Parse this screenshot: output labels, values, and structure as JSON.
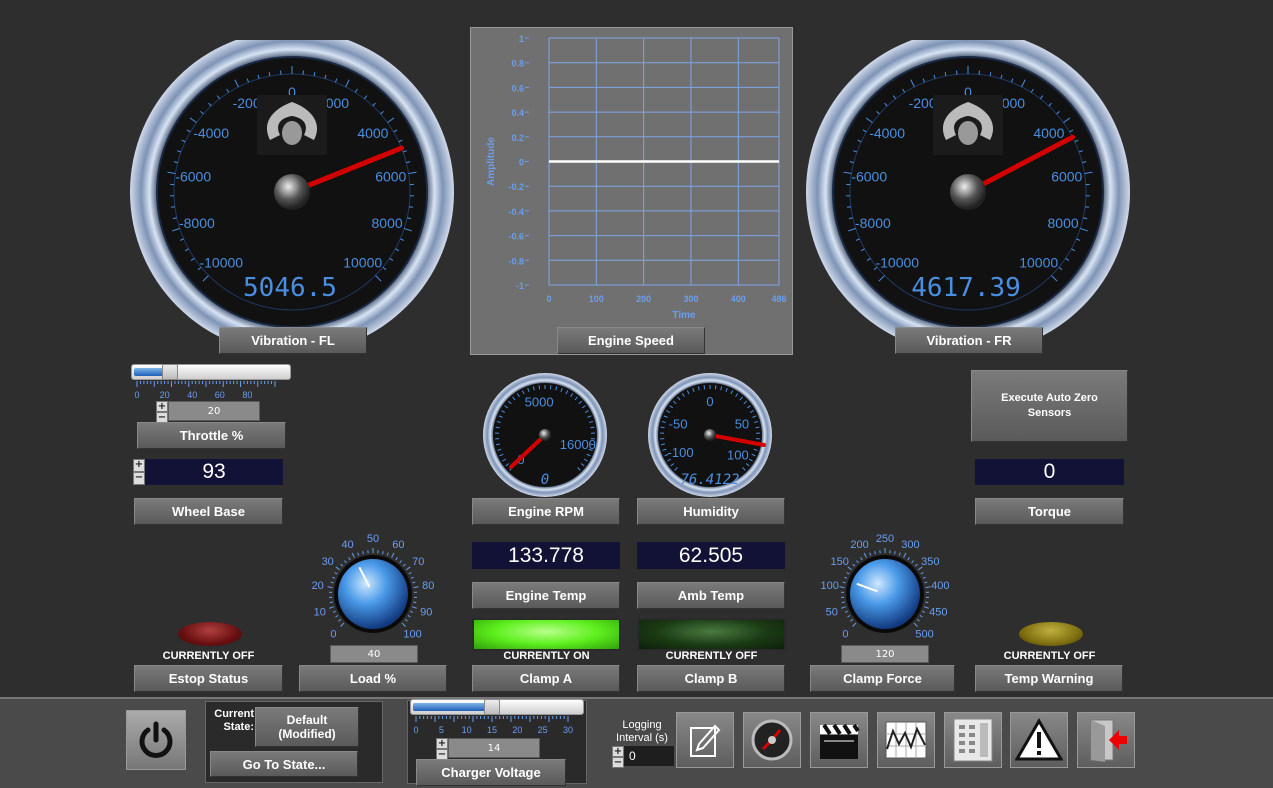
{
  "gauges": {
    "fl": {
      "label": "Vibration - FL",
      "display": "5046.5",
      "value": 5046.5,
      "ticks": [
        "-10000",
        "-8000",
        "-6000",
        "-4000",
        "-200",
        "0",
        "000",
        "4000",
        "6000",
        "8000",
        "10000"
      ]
    },
    "fr": {
      "label": "Vibration - FR",
      "display": "4617.39",
      "value": 4617.39,
      "ticks": [
        "-10000",
        "-8000",
        "-6000",
        "-4000",
        "-200",
        "0",
        "000",
        "4000",
        "6000",
        "8000",
        "10000"
      ]
    }
  },
  "graph": {
    "label": "Engine Speed",
    "ylabel": "Amplitude",
    "xlabel": "Time",
    "yticks": [
      "1",
      "0.8",
      "0.6",
      "0.4",
      "0.2",
      "0",
      "-0.2",
      "-0.4",
      "-0.6",
      "-0.8",
      "-1"
    ],
    "xticks": [
      "0",
      "100",
      "200",
      "300",
      "400",
      "486"
    ]
  },
  "chart_data": {
    "type": "line",
    "title": "",
    "xlabel": "Time",
    "ylabel": "Amplitude",
    "xlim": [
      0,
      486
    ],
    "ylim": [
      -1,
      1
    ],
    "grid": true,
    "series": [
      {
        "x": [
          0,
          486
        ],
        "y": [
          0,
          0
        ]
      }
    ]
  },
  "throttle": {
    "label": "Throttle %",
    "value": "20",
    "fraction": 0.2,
    "ticks": [
      "0",
      "20",
      "40",
      "60",
      "80"
    ]
  },
  "wheel_base": {
    "label": "Wheel Base",
    "value": "93"
  },
  "engine_rpm": {
    "label": "Engine RPM",
    "display": "0",
    "ticks": [
      "0",
      "5000",
      "16000"
    ]
  },
  "humidity": {
    "label": "Humidity",
    "display": "76.4122",
    "ticks": [
      "-100",
      "-50",
      "0",
      "50",
      "100"
    ]
  },
  "auto_zero": {
    "label": "Execute Auto Zero Sensors"
  },
  "torque": {
    "label": "Torque",
    "value": "0"
  },
  "engine_temp": {
    "label": "Engine Temp",
    "value": "133.778"
  },
  "amb_temp": {
    "label": "Amb Temp",
    "value": "62.505"
  },
  "load": {
    "label": "Load %",
    "value": "40",
    "ticks": [
      "0",
      "10",
      "20",
      "30",
      "40",
      "50",
      "60",
      "70",
      "80",
      "90",
      "100"
    ]
  },
  "clamp_force": {
    "label": "Clamp Force",
    "value": "120",
    "ticks": [
      "0",
      "50",
      "100",
      "150",
      "200",
      "250",
      "300",
      "350",
      "400",
      "450",
      "500"
    ]
  },
  "estop": {
    "label": "Estop Status",
    "state": "CURRENTLY OFF",
    "color": "#6a1010"
  },
  "clamp_a": {
    "label": "Clamp A",
    "state": "CURRENTLY ON",
    "color": "#5ef01e"
  },
  "clamp_b": {
    "label": "Clamp B",
    "state": "CURRENTLY OFF",
    "color": "#1a3a14"
  },
  "temp_warning": {
    "label": "Temp Warning",
    "state": "CURRENTLY OFF",
    "color": "#807010"
  },
  "bottom": {
    "current_state_label": "Current State:",
    "state_value": "Default (Modified)",
    "goto_label": "Go To State...",
    "charger": {
      "label": "Charger Voltage",
      "value": "14",
      "fraction": 0.467,
      "ticks": [
        "0",
        "5",
        "10",
        "15",
        "20",
        "25",
        "30"
      ]
    },
    "logging_label": "Logging Interval (s)",
    "logging_value": "0"
  },
  "icons": [
    "power-icon",
    "edit-note-icon",
    "gauge-icon",
    "clapperboard-icon",
    "chart-icon",
    "control-panel-icon",
    "warning-icon",
    "exit-icon"
  ]
}
